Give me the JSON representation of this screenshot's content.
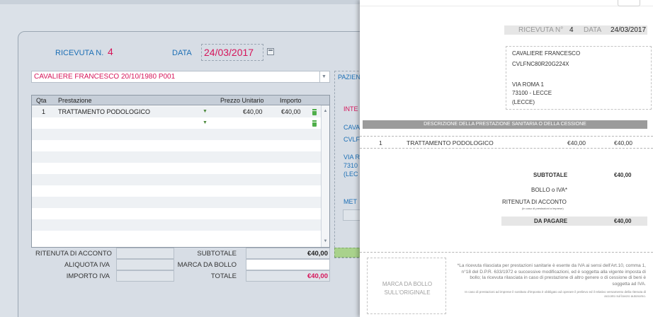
{
  "editor": {
    "receipt_label": "RICEVUTA N.",
    "receipt_number": "4",
    "date_label": "DATA",
    "date_value": "24/03/2017",
    "patient_select": "CAVALIERE  FRANCESCO  20/10/1980   P001",
    "grid": {
      "headers": [
        "Qta",
        "Prestazione",
        "Prezzo Unitario",
        "Importo"
      ],
      "rows": [
        {
          "qty": "1",
          "service": "TRATTAMENTO PODOLOGICO",
          "unit_price": "€40,00",
          "amount": "€40,00"
        },
        {
          "qty": "",
          "service": "",
          "unit_price": "",
          "amount": ""
        }
      ]
    },
    "footer": {
      "withholding_label": "RITENUTA DI ACCONTO",
      "vat_rate_label": "ALIQUOTA IVA",
      "vat_amount_label": "IMPORTO IVA",
      "subtotal_label": "SUBTOTALE",
      "subtotal_value": "€40,00",
      "stamp_label": "MARCA DA BOLLO",
      "total_label": "TOTALE",
      "total_value": "€40,00"
    },
    "side_panel": {
      "lines": [
        "PAZIEN",
        "INTE",
        "CAVA",
        "CVLF",
        "VIA R",
        "7310",
        "(LEC",
        "MET"
      ]
    }
  },
  "document": {
    "receipt_label": "RICEVUTA N°",
    "receipt_number": "4",
    "date_label": "DATA",
    "date_value": "24/03/2017",
    "address_lines": [
      "CAVALIERE FRANCESCO",
      "CVLFNC80R20G224X",
      "VIA ROMA 1",
      "73100 - LECCE",
      "(LECCE)"
    ],
    "description_header": "DESCRIZIONE DELLA PRESTAZIONE SANITARIA O DELLA CESSIONE",
    "item": {
      "qty": "1",
      "service": "TRATTAMENTO PODOLOGICO",
      "unit_price": "€40,00",
      "amount": "€40,00"
    },
    "subtotal_label": "SUBTOTALE",
    "subtotal_value": "€40,00",
    "stamp_vat_label": "BOLLO o IVA*",
    "withholding_label": "RITENUTA DI ACCONTO",
    "withholding_note": "(in caso di prestazioni a imprese)",
    "to_pay_label": "DA PAGARE",
    "to_pay_value": "€40,00",
    "stamp_box_line1": "MARCA DA BOLLO",
    "stamp_box_line2": "SULL'ORIGINALE",
    "footnote": "*La ricevuta rilasciata per prestazioni sanitarie è esente da IVA ai sensi dell'Art.10, comma 1, n°18 del D.P.R. 633/1972 e successive modificazioni, ed è soggetta alla vigente imposta di bollo; la ricevuta rilasciata in caso di prestazione di altro genere o di cessione di beni è soggetta ad IVA.",
    "footnote_small": "In caso di prestazioni ad imprese il sostituto d'imposta è obbligato ad operare il prelievo ed il relativo versamento della ritenuta di acconto sul lavoro autonomo."
  },
  "colors": {
    "accent_red": "#d6155a",
    "label_blue": "#1c6fb5",
    "icon_green": "#4fae4a"
  }
}
